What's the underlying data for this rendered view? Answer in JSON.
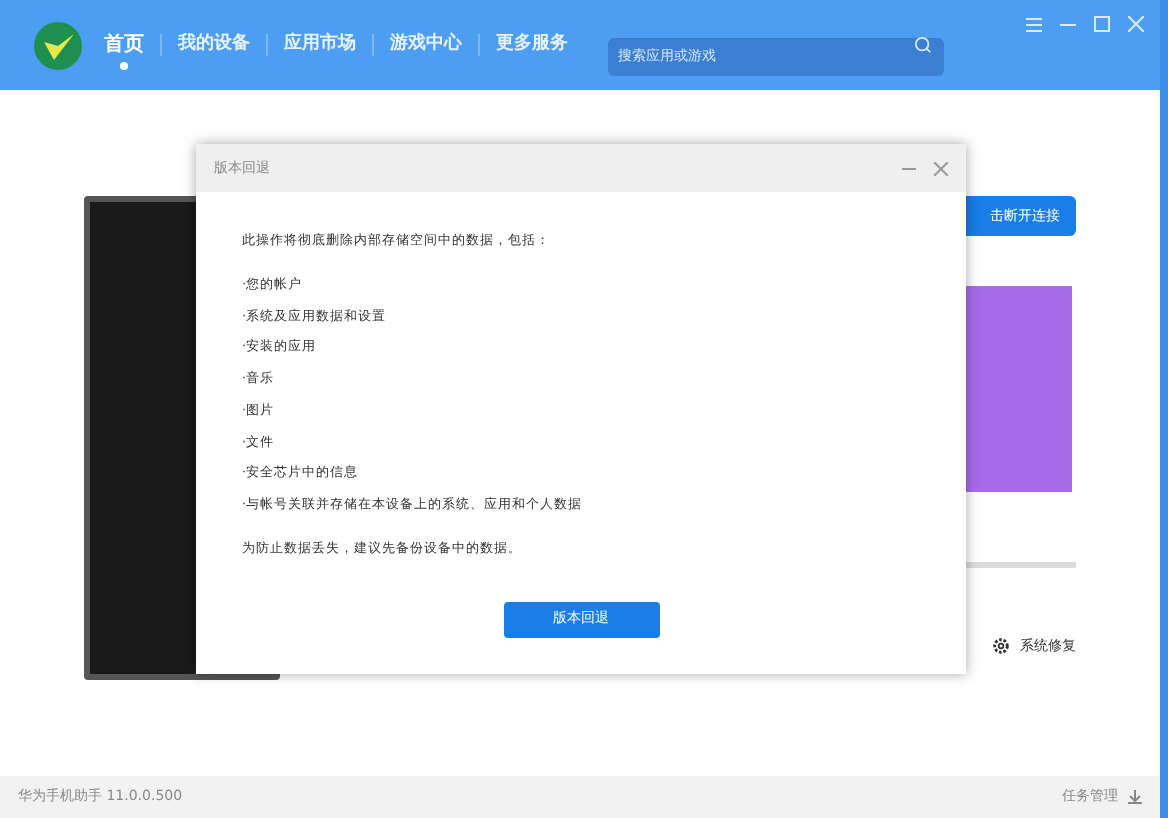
{
  "nav": {
    "tabs": [
      {
        "label": "首页",
        "selected": true
      },
      {
        "label": "我的设备",
        "selected": false
      },
      {
        "label": "应用市场",
        "selected": false
      },
      {
        "label": "游戏中心",
        "selected": false
      },
      {
        "label": "更多服务",
        "selected": false
      }
    ],
    "search": {
      "placeholder": "搜索应用或游戏"
    }
  },
  "device_panel": {
    "connect_button": "击断开连接",
    "repair": "系统修复"
  },
  "dialog": {
    "title": "版本回退",
    "intro": "此操作将彻底删除内部存储空间中的数据，包括：",
    "items": [
      "·您的帐户",
      "·系统及应用数据和设置",
      "·安装的应用",
      "·音乐",
      "·图片",
      "·文件",
      "·安全芯片中的信息",
      "·与帐号关联并存储在本设备上的系统、应用和个人数据"
    ],
    "note": "为防止数据丢失，建议先备份设备中的数据。",
    "button": "版本回退"
  },
  "status_bar": {
    "version": "华为手机助手 11.0.0.500",
    "task": "任务管理"
  }
}
